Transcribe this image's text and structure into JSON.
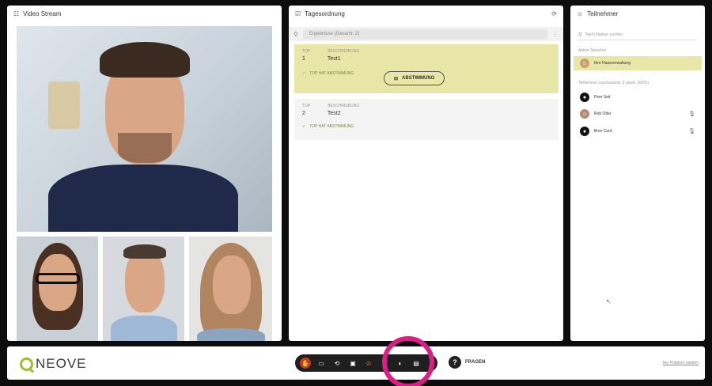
{
  "video": {
    "title": "Video Stream"
  },
  "agenda": {
    "title": "Tagesordnung",
    "filter_label": "Ergebnisse (Gesamt: 2)",
    "items": [
      {
        "top_label": "TOP",
        "desc_label": "BESCHREIBUNG",
        "number": "1",
        "name": "Test1",
        "status": "TOP HAT ABSTIMMUNG",
        "vote_button": "ABSTIMMUNG",
        "active": true
      },
      {
        "top_label": "TOP",
        "desc_label": "BESCHREIBUNG",
        "number": "2",
        "name": "Test2",
        "status": "TOP HAT ABSTIMMUNG",
        "active": false
      }
    ]
  },
  "participants": {
    "title": "Teilnehmer",
    "search_placeholder": "Nach Namen suchen",
    "speaker_section": "Aktive Sprecher",
    "speaker": "Ihre Hausverwaltung",
    "list_section": "Teilnehmer zuschauend: 3 (anwl. 100%)",
    "list": [
      {
        "name": "Peer Seit"
      },
      {
        "name": "Rob Otter"
      },
      {
        "name": "Brev Card"
      }
    ]
  },
  "footer": {
    "logo_text": "NEOVE",
    "fragen_label": "FRAGEN",
    "problem_link": "Ein Problem melden"
  },
  "colors": {
    "highlight": "#e8e7a8",
    "brand_green": "#9bbf2f",
    "ring": "#d91f84",
    "mic_muted": "#c0392b"
  }
}
